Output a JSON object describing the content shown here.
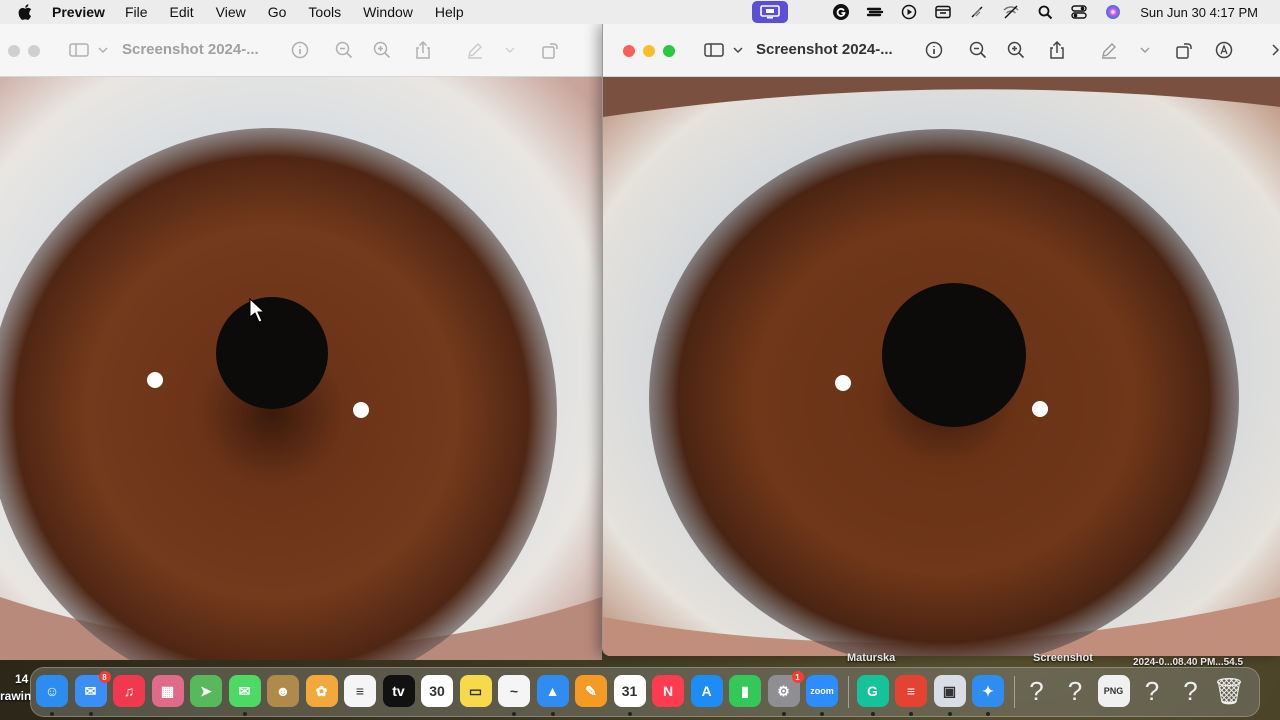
{
  "menubar": {
    "app_name": "Preview",
    "menus": [
      "File",
      "Edit",
      "View",
      "Go",
      "Tools",
      "Window",
      "Help"
    ],
    "status_icons": [
      "screen-share-icon",
      "grammarly-icon",
      "stack-icon",
      "play-icon",
      "calendar-widget-icon",
      "wifi-off-icon",
      "network-off-icon",
      "search-icon",
      "control-center-icon",
      "siri-icon"
    ],
    "clock": "Sun Jun 30  4:17 PM"
  },
  "left_window": {
    "title": "Screenshot 2024-...",
    "focused": false
  },
  "right_window": {
    "title": "Screenshot 2024-...",
    "focused": true
  },
  "desktop_labels": {
    "file1": "Maturska",
    "file2": "Screenshot",
    "file3": "2024-0...08.40 PM...54.5",
    "side_top": "14",
    "side_bottom": "rawin"
  },
  "dock": {
    "apps": [
      {
        "name": "Finder",
        "icon": "finder-icon",
        "color": "#2d8cf0",
        "glyph": "☺",
        "running": true
      },
      {
        "name": "Mail",
        "icon": "mail-icon",
        "color": "#3b8ef5",
        "glyph": "✉",
        "running": true,
        "badge": "8"
      },
      {
        "name": "Music",
        "icon": "music-icon",
        "color": "#f0394f",
        "glyph": "♫",
        "running": false
      },
      {
        "name": "Launchpad",
        "icon": "launchpad-icon",
        "color": "#e06a8a",
        "glyph": "▦",
        "running": false
      },
      {
        "name": "Maps",
        "icon": "maps-icon",
        "color": "#58b85c",
        "glyph": "➤",
        "running": false
      },
      {
        "name": "Messages",
        "icon": "messages-icon",
        "color": "#4cd964",
        "glyph": "✉",
        "running": true
      },
      {
        "name": "Contacts",
        "icon": "contacts-icon",
        "color": "#b08a4a",
        "glyph": "☻",
        "running": false
      },
      {
        "name": "Photos",
        "icon": "photos-icon",
        "color": "#f2a93b",
        "glyph": "✿",
        "running": false
      },
      {
        "name": "Reminders",
        "icon": "reminders-icon",
        "color": "#f5f5f5",
        "glyph": "≡",
        "running": false
      },
      {
        "name": "TV",
        "icon": "tv-icon",
        "color": "#111111",
        "glyph": "tv",
        "running": false
      },
      {
        "name": "Calendar",
        "icon": "calendar-icon",
        "color": "#ffffff",
        "glyph": "30",
        "running": false
      },
      {
        "name": "Notes",
        "icon": "notes-icon",
        "color": "#f7d94c",
        "glyph": "▭",
        "running": false
      },
      {
        "name": "Freeform",
        "icon": "freeform-icon",
        "color": "#f5f5f5",
        "glyph": "~",
        "running": true
      },
      {
        "name": "Keynote",
        "icon": "keynote-icon",
        "color": "#2f8cf0",
        "glyph": "▲",
        "running": true
      },
      {
        "name": "Pages",
        "icon": "pages-icon",
        "color": "#f59a23",
        "glyph": "✎",
        "running": false
      },
      {
        "name": "Google Calendar",
        "icon": "google-calendar-icon",
        "color": "#ffffff",
        "glyph": "31",
        "running": true
      },
      {
        "name": "News",
        "icon": "news-icon",
        "color": "#ff3b4f",
        "glyph": "N",
        "running": false
      },
      {
        "name": "App Store",
        "icon": "app-store-icon",
        "color": "#1d8cf5",
        "glyph": "A",
        "running": false
      },
      {
        "name": "Numbers",
        "icon": "numbers-icon",
        "color": "#34c759",
        "glyph": "▮",
        "running": false
      },
      {
        "name": "System Settings",
        "icon": "settings-icon",
        "color": "#8e8e93",
        "glyph": "⚙",
        "running": true,
        "badge": "1"
      },
      {
        "name": "Zoom",
        "icon": "zoom-icon",
        "color": "#2d8cff",
        "glyph": "zoom",
        "running": true
      },
      {
        "name": "Grammarly",
        "icon": "grammarly-icon",
        "color": "#15c39a",
        "glyph": "G",
        "running": true
      },
      {
        "name": "Todoist",
        "icon": "todoist-icon",
        "color": "#e44332",
        "glyph": "≡",
        "running": true
      },
      {
        "name": "Preview",
        "icon": "preview-icon",
        "color": "#d8dde6",
        "glyph": "▣",
        "running": true
      },
      {
        "name": "Safari",
        "icon": "safari-icon",
        "color": "#2f8cf0",
        "glyph": "✦",
        "running": true
      },
      {
        "name": "Unknown 1",
        "icon": "question-icon",
        "color": "transparent",
        "glyph": "?",
        "running": false
      },
      {
        "name": "Unknown 2",
        "icon": "question-icon",
        "color": "transparent",
        "glyph": "?",
        "running": false
      },
      {
        "name": "PNG File",
        "icon": "png-file-icon",
        "color": "#f0f0f0",
        "glyph": "PNG",
        "running": false
      },
      {
        "name": "Unknown 3",
        "icon": "question-icon",
        "color": "transparent",
        "glyph": "?",
        "running": false
      },
      {
        "name": "Unknown 4",
        "icon": "question-icon",
        "color": "transparent",
        "glyph": "?",
        "running": false
      },
      {
        "name": "Trash",
        "icon": "trash-icon",
        "color": "transparent",
        "glyph": "🗑",
        "running": false
      }
    ]
  }
}
